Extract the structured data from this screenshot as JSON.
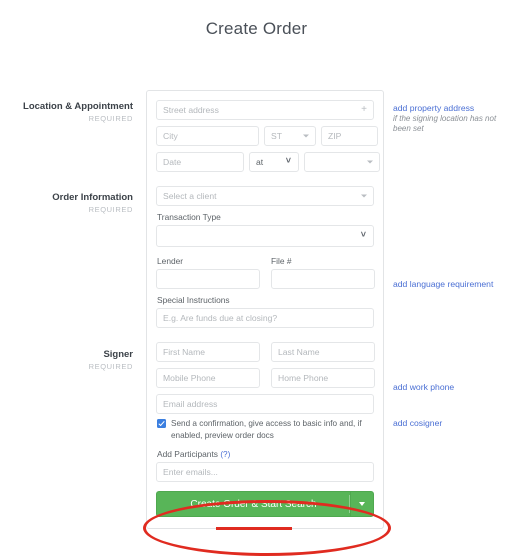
{
  "header": {
    "title": "Create Order"
  },
  "sections": {
    "location": {
      "title": "Location & Appointment",
      "required": "REQUIRED"
    },
    "order": {
      "title": "Order Information",
      "required": "REQUIRED"
    },
    "signer": {
      "title": "Signer",
      "required": "REQUIRED"
    }
  },
  "fields": {
    "street_address": {
      "placeholder": "Street address",
      "value": "",
      "add_icon": "plus-icon"
    },
    "city": {
      "placeholder": "City",
      "value": ""
    },
    "state": {
      "placeholder": "ST",
      "value": ""
    },
    "zip": {
      "placeholder": "ZIP",
      "value": ""
    },
    "date": {
      "placeholder": "Date",
      "value": ""
    },
    "at": {
      "value": "at"
    },
    "time": {
      "value": ""
    },
    "client": {
      "placeholder": "Select a client",
      "value": ""
    },
    "transaction_type_label": "Transaction Type",
    "transaction_type": {
      "value": ""
    },
    "lender_label": "Lender",
    "lender": {
      "value": ""
    },
    "file_number_label": "File #",
    "file_number": {
      "value": ""
    },
    "special_instructions_label": "Special Instructions",
    "special_instructions": {
      "placeholder": "E.g. Are funds due at closing?",
      "value": ""
    },
    "first_name": {
      "placeholder": "First Name",
      "value": ""
    },
    "last_name": {
      "placeholder": "Last Name",
      "value": ""
    },
    "mobile_phone": {
      "placeholder": "Mobile Phone",
      "value": ""
    },
    "home_phone": {
      "placeholder": "Home Phone",
      "value": ""
    },
    "email": {
      "placeholder": "Email address",
      "value": ""
    },
    "participants_label": "Add Participants",
    "participants_help": "(?)",
    "participants": {
      "placeholder": "Enter emails...",
      "value": ""
    }
  },
  "confirmation_checkbox": {
    "checked": true,
    "label": "Send a confirmation, give access to basic info and, if enabled, preview order docs"
  },
  "links": {
    "property_address": "add property address",
    "property_address_note": "if the signing location has not been set",
    "language_requirement": "add language requirement",
    "work_phone": "add work phone",
    "cosigner": "add cosigner"
  },
  "submit": {
    "label": "Create Order & Start Search",
    "dropdown_icon": "caret-down-icon"
  },
  "colors": {
    "submit_green": "#58b558",
    "link_blue": "#4a6fd4",
    "checkbox_blue": "#3b7fe0",
    "annotation_red": "#e02b20"
  }
}
